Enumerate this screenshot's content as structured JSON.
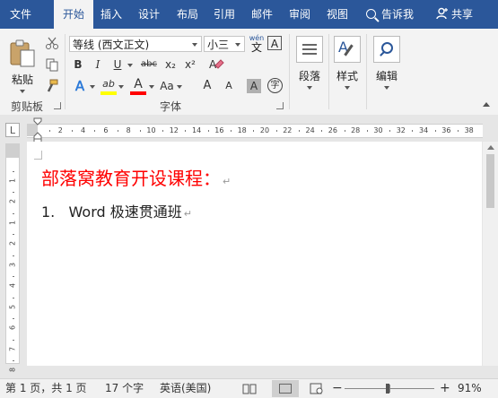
{
  "tabs": [
    {
      "label": "文件",
      "active": false
    },
    {
      "label": "开始",
      "active": true
    },
    {
      "label": "插入",
      "active": false
    },
    {
      "label": "设计",
      "active": false
    },
    {
      "label": "布局",
      "active": false
    },
    {
      "label": "引用",
      "active": false
    },
    {
      "label": "邮件",
      "active": false
    },
    {
      "label": "审阅",
      "active": false
    },
    {
      "label": "视图",
      "active": false
    }
  ],
  "tell_me": "告诉我",
  "share": "共享",
  "clipboard": {
    "paste_label": "粘贴",
    "group_label": "剪贴板"
  },
  "font": {
    "name": "等线 (西文正文)",
    "size": "小三",
    "wen_label": "wén",
    "wen_char": "文",
    "boxed_a": "A",
    "bold": "B",
    "italic": "I",
    "underline": "U",
    "strike": "abc",
    "subscript": "x₂",
    "superscript": "x²",
    "effects": "A",
    "highlight": "ab",
    "font_color": "A",
    "change_case": "Aa",
    "grow": "A",
    "shrink": "A",
    "shading": "A",
    "enclose": "字",
    "group_label": "字体",
    "highlight_color": "#ffff00",
    "font_color_value": "#ff0000"
  },
  "paragraph": {
    "label": "段落"
  },
  "styles": {
    "label": "样式"
  },
  "editing": {
    "label": "编辑"
  },
  "ruler": {
    "corner": "L",
    "numbers": [
      "2",
      "4",
      "6",
      "8",
      "10",
      "12",
      "14",
      "16",
      "18",
      "20",
      "22",
      "24",
      "26",
      "28",
      "30",
      "32",
      "34",
      "36",
      "38"
    ],
    "vertical_numbers": [
      "1",
      "2",
      "1",
      "2",
      "3",
      "4",
      "5",
      "6",
      "7",
      "8"
    ]
  },
  "document": {
    "heading": "部落窝教育开设课程：",
    "list_items": [
      {
        "number": "1.",
        "text": "Word 极速贯通班"
      }
    ],
    "para_mark": "↵"
  },
  "status": {
    "page": "第 1 页，共 1 页",
    "words": "17 个字",
    "language": "英语(美国)",
    "zoom_minus": "−",
    "zoom_plus": "+",
    "zoom": "91%"
  },
  "colors": {
    "accent": "#2b579a",
    "heading": "#ff0000"
  }
}
